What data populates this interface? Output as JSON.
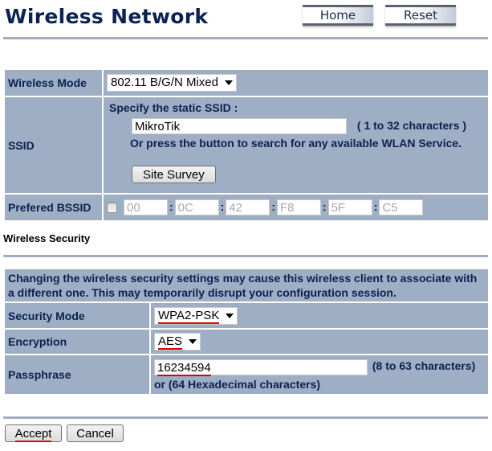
{
  "header": {
    "title": "Wireless Network",
    "home_label": "Home",
    "reset_label": "Reset"
  },
  "network": {
    "wireless_mode": {
      "label": "Wireless Mode",
      "value": "802.11 B/G/N Mixed"
    },
    "ssid": {
      "label": "SSID",
      "instruction": "Specify the static SSID  :",
      "value": "MikroTik",
      "hint": "( 1 to 32 characters )",
      "survey_text": "Or press the button to search for any available WLAN Service.",
      "site_survey_label": "Site Survey"
    },
    "preferred_bssid": {
      "label": "Prefered BSSID",
      "checked": false,
      "octets": [
        "00",
        "0C",
        "42",
        "F8",
        "5F",
        "C5"
      ],
      "separator": ":"
    }
  },
  "security": {
    "section_title": "Wireless Security",
    "warning": "Changing the wireless security settings may cause this wireless client to associate with a different one. This may temporarily disrupt your configuration session.",
    "security_mode": {
      "label": "Security Mode",
      "value": "WPA2-PSK"
    },
    "encryption": {
      "label": "Encryption",
      "value": "AES"
    },
    "passphrase": {
      "label": "Passphrase",
      "value": "16234594",
      "hint": "(8 to 63 characters) or (64 Hexadecimal characters)"
    }
  },
  "footer": {
    "accept_label": "Accept",
    "cancel_label": "Cancel"
  },
  "colors": {
    "title": "#0a2352",
    "cell_bg": "#9eaec4",
    "rule": "#a2adc0",
    "annotation_red": "#e00000"
  }
}
